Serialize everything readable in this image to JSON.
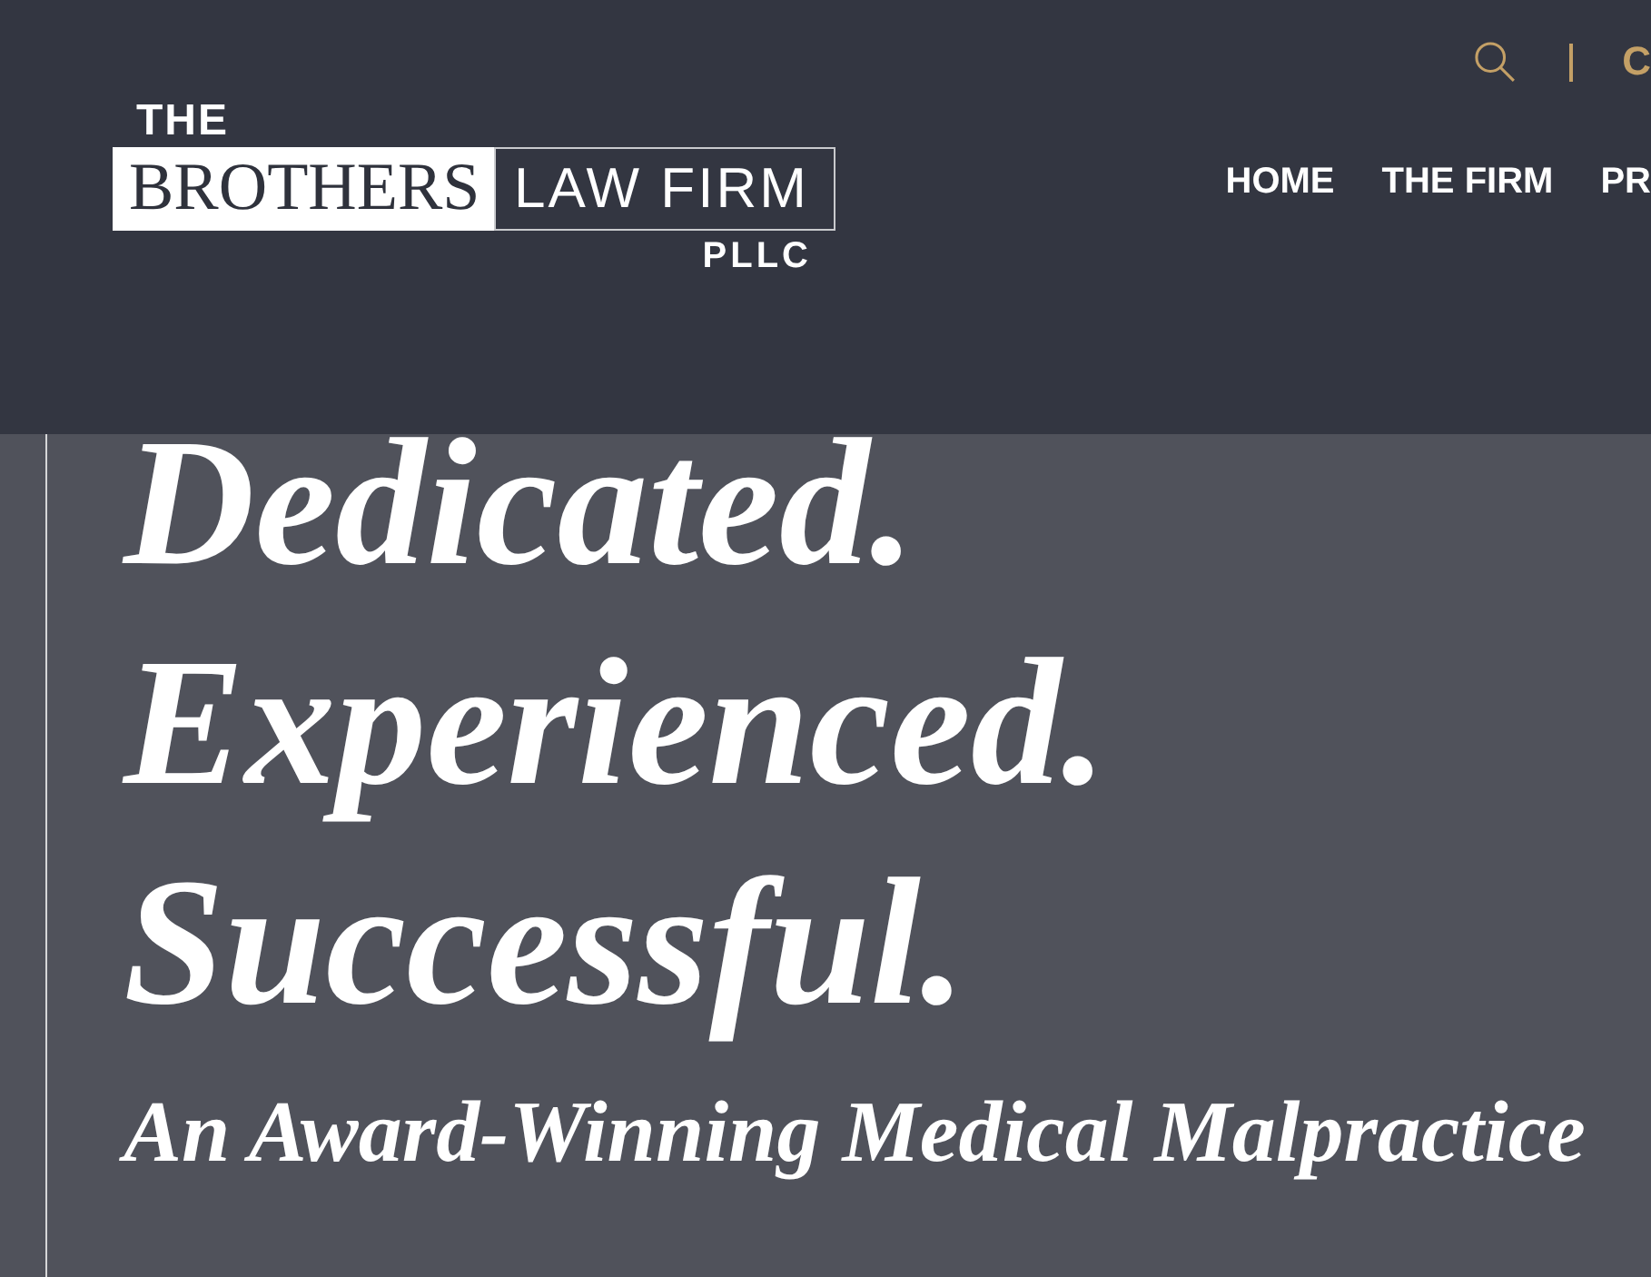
{
  "header": {
    "logo": {
      "top": "THE",
      "name": "BROTHERS",
      "firm": "LAW FIRM",
      "suffix": "PLLC"
    },
    "utility": {
      "link": "C"
    },
    "nav": [
      {
        "label": "HOME"
      },
      {
        "label": "THE FIRM"
      },
      {
        "label": "PR"
      }
    ]
  },
  "hero": {
    "headline_lines": [
      "Dedicated.",
      "Experienced.",
      "Successful."
    ],
    "tagline": "An Award-Winning Medical Malpractice"
  }
}
